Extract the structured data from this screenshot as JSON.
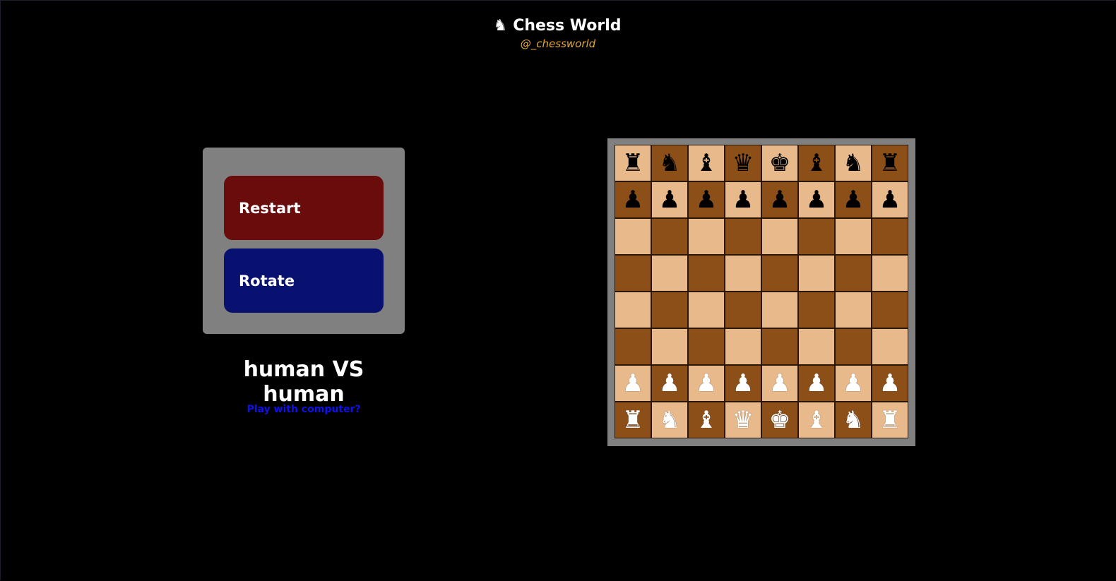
{
  "header": {
    "logo_icon": "♞",
    "title": "Chess World",
    "handle": "@_chessworld"
  },
  "controls": {
    "restart_label": "Restart",
    "restart_color": "#6a0c0c",
    "rotate_label": "Rotate",
    "rotate_color": "#081070"
  },
  "mode": {
    "label": "human VS human",
    "switch_link": "Play with computer?"
  },
  "board": {
    "light_color": "#e8b98a",
    "dark_color": "#8b4f17",
    "rows": [
      [
        "♜",
        "♞",
        "♝",
        "♛",
        "♚",
        "♝",
        "♞",
        "♜"
      ],
      [
        "♟",
        "♟",
        "♟",
        "♟",
        "♟",
        "♟",
        "♟",
        "♟"
      ],
      [
        "",
        "",
        "",
        "",
        "",
        "",
        "",
        ""
      ],
      [
        "",
        "",
        "",
        "",
        "",
        "",
        "",
        ""
      ],
      [
        "",
        "",
        "",
        "",
        "",
        "",
        "",
        ""
      ],
      [
        "",
        "",
        "",
        "",
        "",
        "",
        "",
        ""
      ],
      [
        "♟",
        "♟",
        "♟",
        "♟",
        "♟",
        "♟",
        "♟",
        "♟"
      ],
      [
        "♜",
        "♞",
        "♝",
        "♛",
        "♚",
        "♝",
        "♞",
        "♜"
      ]
    ],
    "piece_colors": [
      [
        "black",
        "black",
        "black",
        "black",
        "black",
        "black",
        "black",
        "black"
      ],
      [
        "black",
        "black",
        "black",
        "black",
        "black",
        "black",
        "black",
        "black"
      ],
      [
        "",
        "",
        "",
        "",
        "",
        "",
        "",
        ""
      ],
      [
        "",
        "",
        "",
        "",
        "",
        "",
        "",
        ""
      ],
      [
        "",
        "",
        "",
        "",
        "",
        "",
        "",
        ""
      ],
      [
        "",
        "",
        "",
        "",
        "",
        "",
        "",
        ""
      ],
      [
        "white",
        "white",
        "white",
        "white",
        "white",
        "white",
        "white",
        "white"
      ],
      [
        "white",
        "white",
        "white",
        "white",
        "white",
        "white",
        "white",
        "white"
      ]
    ]
  }
}
